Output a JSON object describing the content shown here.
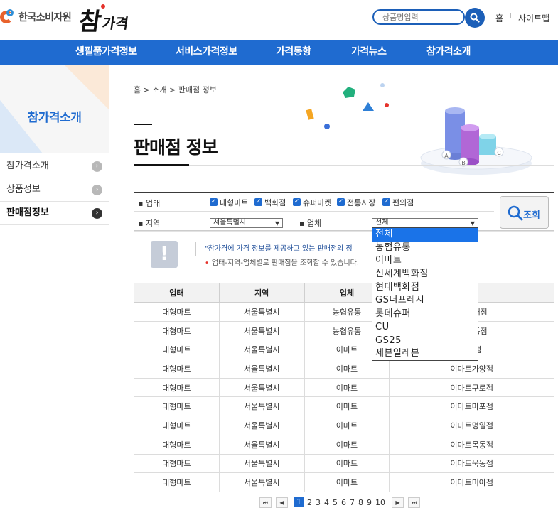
{
  "header": {
    "org_name": "한국소비자원",
    "brand_main": "참",
    "brand_sub": "가격",
    "search_placeholder": "상품명입력",
    "util_home": "홈",
    "util_separator": "I",
    "util_sitemap": "사이트맵"
  },
  "gnb": [
    "생필품가격정보",
    "서비스가격정보",
    "가격동향",
    "가격뉴스",
    "참가격소개"
  ],
  "sidebar": {
    "title": "참가격소개",
    "items": [
      {
        "label": "참가격소개",
        "arrow": "›"
      },
      {
        "label": "상품정보",
        "arrow": "›"
      },
      {
        "label": "판매점정보",
        "arrow": "›"
      }
    ]
  },
  "breadcrumb": "홈 > 소개 > 판매점 정보",
  "page_title": "판매점 정보",
  "form": {
    "label_type": "업태",
    "label_region": "지역",
    "label_company": "업체",
    "checkboxes": [
      "대형마트",
      "백화점",
      "슈퍼마켓",
      "전통시장",
      "편의점"
    ],
    "region_value": "서울특별시",
    "company_value": "전체",
    "submit_label": "조회"
  },
  "notice": {
    "line1": "\"참가격에 가격 정보를 제공하고 있는 판매점의 정",
    "line2": "업태-지역-업체별로 판매점을 조회할 수 있습니다."
  },
  "table": {
    "headers": [
      "업태",
      "지역",
      "업체",
      "점"
    ],
    "rows": [
      [
        "대형마트",
        "서울특별시",
        "농협유통",
        "농 양재점"
      ],
      [
        "대형마트",
        "서울특별시",
        "농협유통",
        "농 창동점"
      ],
      [
        "대형마트",
        "서울특별시",
        "이마트",
        "트5점"
      ],
      [
        "대형마트",
        "서울특별시",
        "이마트",
        "이마트가양점"
      ],
      [
        "대형마트",
        "서울특별시",
        "이마트",
        "이마트구로점"
      ],
      [
        "대형마트",
        "서울특별시",
        "이마트",
        "이마트마포점"
      ],
      [
        "대형마트",
        "서울특별시",
        "이마트",
        "이마트명일점"
      ],
      [
        "대형마트",
        "서울특별시",
        "이마트",
        "이마트목동점"
      ],
      [
        "대형마트",
        "서울특별시",
        "이마트",
        "이마트묵동점"
      ],
      [
        "대형마트",
        "서울특별시",
        "이마트",
        "이마트미아점"
      ]
    ]
  },
  "pager": {
    "first": "⏮",
    "prev": "◀",
    "pages": [
      "1",
      "2",
      "3",
      "4",
      "5",
      "6",
      "7",
      "8",
      "9",
      "10"
    ],
    "current": "1",
    "next": "▶",
    "last": "⏭"
  },
  "dropdown": {
    "options": [
      "전체",
      "농협유통",
      "이마트",
      "신세계백화점",
      "현대백화점",
      "GS더프레시",
      "롯데슈퍼",
      "CU",
      "GS25",
      "세븐일레븐"
    ],
    "selected": "전체"
  },
  "illustration_labels": [
    "A",
    "B",
    "C"
  ],
  "colors": {
    "primary": "#1f6bd0",
    "accent_red": "#e5322b",
    "dropdown_highlight": "#1a73e8"
  }
}
